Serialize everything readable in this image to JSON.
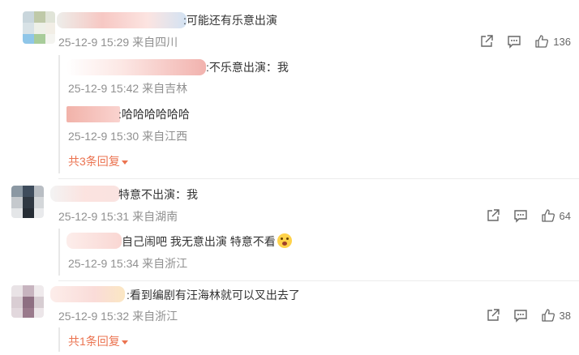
{
  "comments": [
    {
      "text": ":可能还有乐意出演",
      "meta": "25-12-9 15:29 来自四川",
      "like_count": "136",
      "replies": [
        {
          "text": ":不乐意出演：我",
          "meta": "25-12-9 15:42 来自吉林"
        },
        {
          "text": ":哈哈哈哈哈哈",
          "meta": "25-12-9 15:30 来自江西"
        }
      ],
      "more_label": "共3条回复"
    },
    {
      "text": "特意不出演：我",
      "meta": "25-12-9 15:31 来自湖南",
      "like_count": "64",
      "replies": [
        {
          "text": "自己闹吧 我无意出演 特意不看",
          "meta": "25-12-9 15:34 来自浙江"
        }
      ]
    },
    {
      "text": ":看到编剧有汪海林就可以叉出去了",
      "meta": "25-12-9 15:32 来自浙江",
      "like_count": "38",
      "replies": [],
      "more_label": "共1条回复"
    }
  ],
  "icons": {
    "share": "share-icon",
    "comment": "comment-icon",
    "like": "like-icon"
  },
  "colors": {
    "meta": "#909090",
    "more_link": "#eb7350",
    "text": "#333333"
  }
}
